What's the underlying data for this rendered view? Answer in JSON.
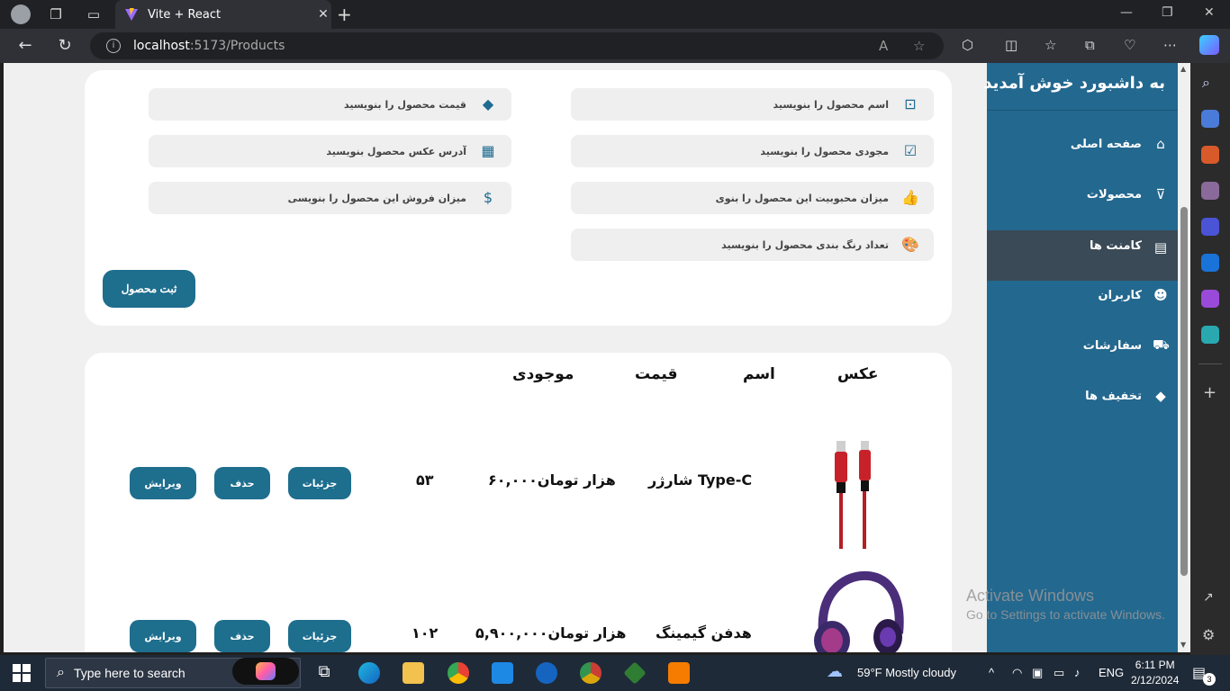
{
  "browser": {
    "tab_title": "Vite + React",
    "url_host": "localhost",
    "url_path": ":5173/Products"
  },
  "sidebar": {
    "title": "به داشبورد خوش آمدید",
    "items": [
      {
        "label": "صفحه اصلی",
        "icon": "home-icon"
      },
      {
        "label": "محصولات",
        "icon": "basket-icon"
      },
      {
        "label": "کامنت ها",
        "icon": "comment-icon"
      },
      {
        "label": "کاربران",
        "icon": "users-icon"
      },
      {
        "label": "سفارشات",
        "icon": "cart-icon"
      },
      {
        "label": "تخفیف ها",
        "icon": "tag-icon"
      }
    ],
    "active_index": 2,
    "color": "#23688f"
  },
  "form": {
    "fields": [
      {
        "placeholder": "اسم محصول را بنویسید",
        "icon": "product-name-icon"
      },
      {
        "placeholder": "قیمت محصول را بنویسید",
        "icon": "price-tag-icon"
      },
      {
        "placeholder": "مجودی محصول را بنویسید",
        "icon": "stock-clipboard-icon"
      },
      {
        "placeholder": "آدرس عکس محصول بنویسید",
        "icon": "image-map-icon"
      },
      {
        "placeholder": "میزان محبوبیت این محصول را بنوی",
        "icon": "thumbs-up-icon"
      },
      {
        "placeholder": "میزان فروش این محصول را بنویسی",
        "icon": "sales-file-icon"
      },
      {
        "placeholder": "تعداد رنگ بندی محصول را بنویسید",
        "icon": "palette-icon"
      }
    ],
    "submit_label": "ثبت محصول"
  },
  "table": {
    "headers": {
      "image": "عکس",
      "name": "اسم",
      "price": "قیمت",
      "stock": "موجودی"
    },
    "rows": [
      {
        "image": "usb-cable-image",
        "name": "شارژر Type-C",
        "price": "۶۰,۰۰۰هزار تومان",
        "stock": "۵۳"
      },
      {
        "image": "gaming-headphone-image",
        "name": "هدفن گیمینگ",
        "price": "۵,۹۰۰,۰۰۰هزار تومان",
        "stock": "۱۰۲"
      }
    ],
    "actions": {
      "details": "جزئیات",
      "delete": "حذف",
      "edit": "ویرایش"
    }
  },
  "watermark": {
    "line1": "Activate Windows",
    "line2": "Go to Settings to activate Windows."
  },
  "taskbar": {
    "search_placeholder": "Type here to search",
    "weather": "59°F  Mostly cloudy",
    "lang": "ENG",
    "time": "6:11 PM",
    "date": "2/12/2024",
    "notifications": "3"
  }
}
